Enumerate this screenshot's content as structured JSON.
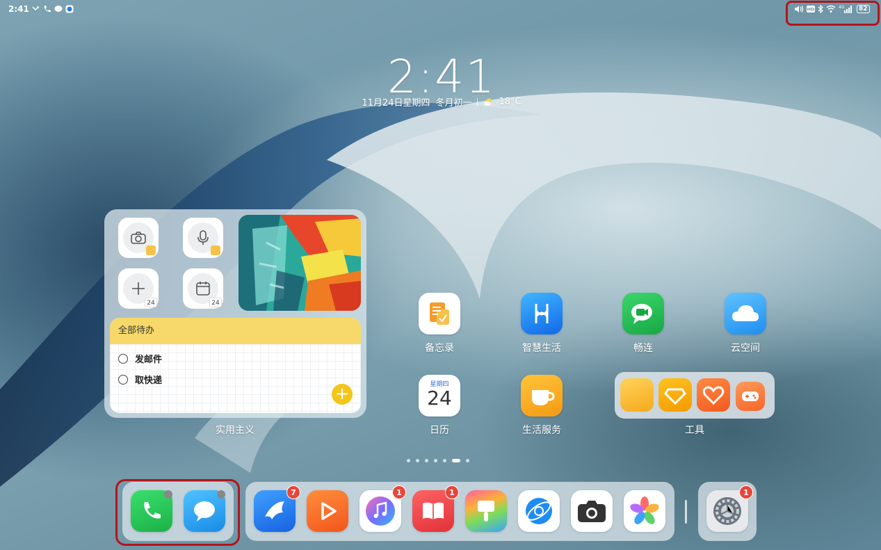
{
  "status_bar": {
    "time": "2:41",
    "left_icons": [
      "missed-call-icon",
      "phone-icon",
      "message-icon",
      "app-notification-icon"
    ],
    "right_icons": [
      "volume-icon",
      "hd-icon",
      "bluetooth-icon",
      "wifi-icon",
      "signal-4g-icon"
    ],
    "network": "4G",
    "battery": "82"
  },
  "clock": {
    "time": "2:41",
    "date": "11月24日星期四",
    "lunar": "冬月初一",
    "temperature": "18°C"
  },
  "widget": {
    "todo_title": "全部待办",
    "todo_items": [
      "发邮件",
      "取快递"
    ],
    "calendar_day_small": "24",
    "label": "实用主义"
  },
  "apps": {
    "memo": "备忘录",
    "smart_life": "智慧生活",
    "meetime": "畅连",
    "cloud": "云空间",
    "calendar": "日历",
    "calendar_weekday": "星期四",
    "calendar_day": "24",
    "life_service": "生活服务",
    "tools_folder": "工具"
  },
  "page_indicator": {
    "count": 7,
    "active_index": 5
  },
  "dock": {
    "badges": {
      "feishu": "7",
      "music": "1",
      "books": "1",
      "settings": "1"
    }
  },
  "colors": {
    "highlight": "#b3141c",
    "badge": "#e8463a",
    "accent_yellow": "#f3c619"
  }
}
